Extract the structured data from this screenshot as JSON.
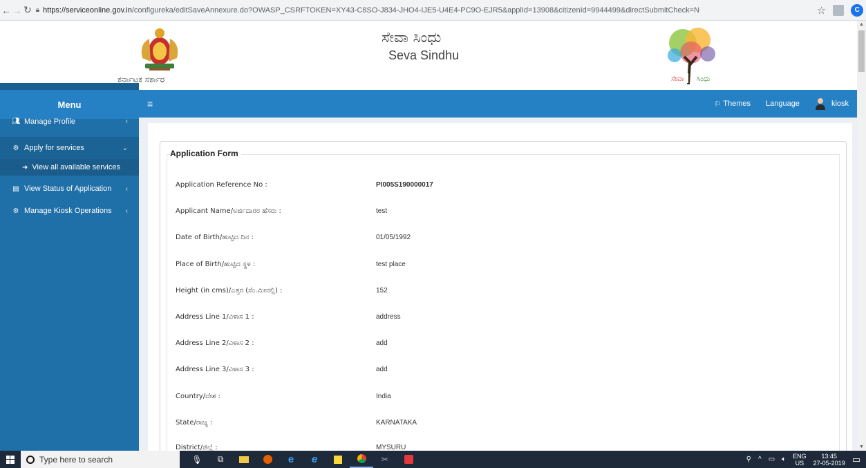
{
  "browser": {
    "url_host": "https://serviceonline.gov.in",
    "url_path": "/configureka/editSaveAnnexure.do?OWASP_CSRFTOKEN=XY43-C8SO-J834-JHO4-IJE5-U4E4-PC9O-EJR5&applId=13908&citizenId=9944499&directSubmitCheck=N",
    "profile_initial": "C"
  },
  "header": {
    "gov_text": "ಕರ್ನಾಟಕ ಸರ್ಕಾರ",
    "brand_kannada": "ಸೇವಾ ಸಿಂಧು",
    "brand_english": "Seva Sindhu",
    "tree_logo_text_left": "ಸೇವಾ",
    "tree_logo_text_right": "ಸಿಂಧು"
  },
  "sidebar": {
    "menu_title": "Menu",
    "items": [
      {
        "label": "Manage Profile"
      },
      {
        "label": "Apply for services"
      },
      {
        "label": "View all available services"
      },
      {
        "label": "View Status of Application"
      },
      {
        "label": "Manage Kiosk Operations"
      }
    ]
  },
  "topbar": {
    "themes_label": "Themes",
    "language_label": "Language",
    "user_name": "kiosk"
  },
  "form": {
    "title": "Application Form",
    "rows": [
      {
        "label": "Application Reference No :",
        "value": "PI005S190000017"
      },
      {
        "label": "Applicant Name/ಅರ್ಜಿದಾರರ ಹೆಸರು :",
        "value": "test"
      },
      {
        "label": "Date of Birth/ಹುಟ್ಟಿದ ದಿನ :",
        "value": "01/05/1992"
      },
      {
        "label": "Place of Birth/ಹುಟ್ಟಿದ ಸ್ಥಳ :",
        "value": "test place"
      },
      {
        "label": "Height (in cms)/ಎತ್ತರ (ಸೆಂ.ಮೀನಲ್ಲಿ) :",
        "value": "152"
      },
      {
        "label": "Address Line 1/ವಿಳಾಸ 1 :",
        "value": "address"
      },
      {
        "label": "Address Line 2/ವಿಳಾಸ 2 :",
        "value": "add"
      },
      {
        "label": "Address Line 3/ವಿಳಾಸ 3 :",
        "value": "add"
      },
      {
        "label": "Country/ದೇಶ :",
        "value": "India"
      },
      {
        "label": "State/ರಾಜ್ಯ :",
        "value": "KARNATAKA"
      },
      {
        "label": "District/ಜಿಲ್ಲೆ :",
        "value": "MYSURU"
      }
    ]
  },
  "taskbar": {
    "search_placeholder": "Type here to search",
    "lang_top": "ENG",
    "lang_bottom": "US",
    "time": "13:45",
    "date": "27-05-2019"
  },
  "colors": {
    "sidebar": "#1f6fa8",
    "topbar": "#2581c4",
    "content_bg": "#ecf0f5"
  }
}
